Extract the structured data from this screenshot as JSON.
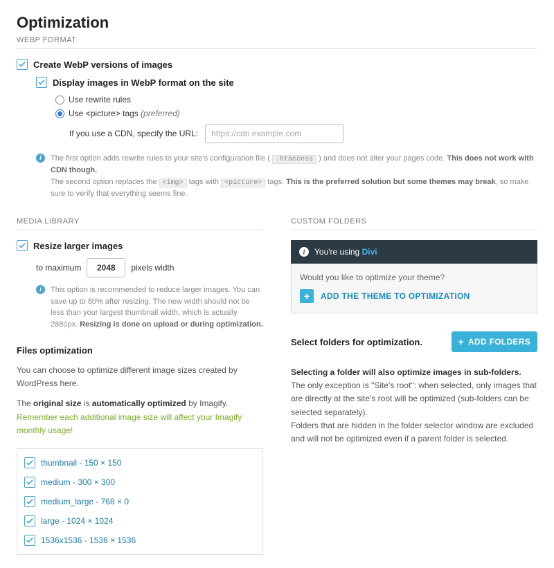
{
  "page_title": "Optimization",
  "sections": {
    "webp": {
      "title": "WEBP FORMAT",
      "create_label": "Create WebP versions of images",
      "display_label": "Display images in WebP format on the site",
      "radio_rewrite": "Use rewrite rules",
      "radio_picture_prefix": "Use ",
      "radio_picture_code": "<picture>",
      "radio_picture_suffix": " tags ",
      "radio_picture_pref": "(preferred)",
      "cdn_label": "If you use a CDN, specify the URL:",
      "cdn_placeholder": "https://cdn.example.com",
      "info_line1_a": "The first option adds rewrite rules to your site's configuration file ( ",
      "info_line1_code": ".htaccess",
      "info_line1_b": " ) and does not alter your pages code. ",
      "info_line1_bold": "This does not work with CDN though.",
      "info_line2_a": "The second option replaces the ",
      "info_line2_code1": "<img>",
      "info_line2_b": " tags with ",
      "info_line2_code2": "<picture>",
      "info_line2_c": " tags. ",
      "info_line2_bold": "This is the preferred solution but some themes may break",
      "info_line2_d": ", so make sure to verify that everything seems fine."
    },
    "media": {
      "title": "MEDIA LIBRARY",
      "resize_label": "Resize larger images",
      "to_max": "to maximum",
      "max_value": "2048",
      "px_width": "pixels width",
      "info_a": "This option is recommended to reduce larger images. You can save up to 80% after resizing. The new width should not be less than your largest thumbnail width, which is actually 2880px. ",
      "info_bold": "Resizing is done on upload or during optimization."
    },
    "files": {
      "title": "Files optimization",
      "line1": "You can choose to optimize different image sizes created by WordPress here.",
      "line2a": "The ",
      "line2b": "original size",
      "line2c": " is ",
      "line2d": "automatically optimized",
      "line2e": " by Imagify.",
      "line3": "Remember each additional image size will affect your Imagify monthly usage!",
      "sizes": [
        "thumbnail - 150 × 150",
        "medium - 300 × 300",
        "medium_large - 768 × 0",
        "large - 1024 × 1024",
        "1536x1536 - 1536 × 1536"
      ]
    },
    "custom": {
      "title": "CUSTOM FOLDERS",
      "using_prefix": "You're using ",
      "using_theme": "Divi",
      "question": "Would you like to optimize your theme?",
      "add_theme": "ADD THE THEME TO OPTIMIZATION",
      "select_label": "Select folders for optimization.",
      "add_folders": "ADD FOLDERS",
      "note_bold": "Selecting a folder will also optimize images in sub-folders.",
      "note_a": " The only exception is \"Site's root\": when selected, only images that are directly at the site's root will be optimized (sub-folders can be selected separately).",
      "note_b": "Folders that are hidden in the folder selector window are excluded and will not be optimized even if a parent folder is selected."
    }
  }
}
